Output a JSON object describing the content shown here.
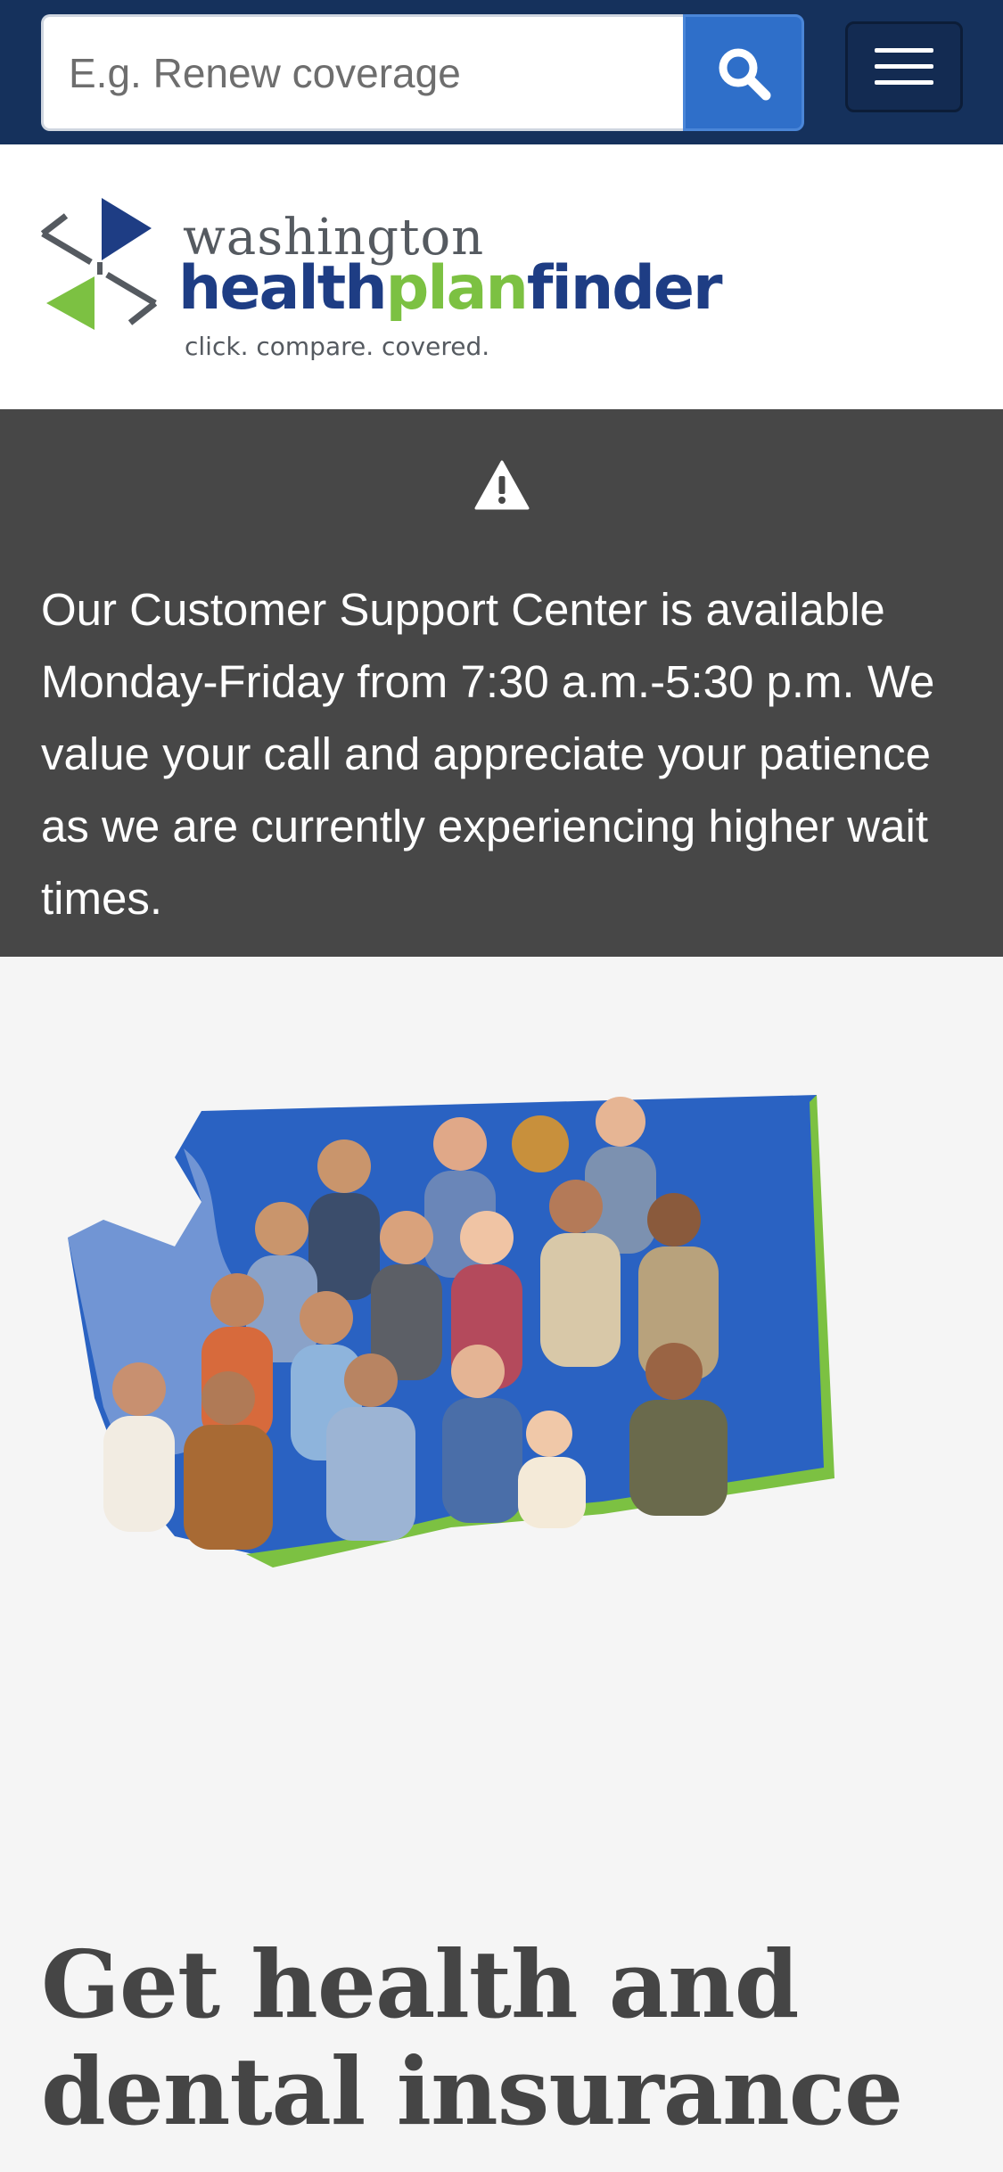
{
  "search": {
    "placeholder": "E.g. Renew coverage",
    "button_icon": "search-icon"
  },
  "menu": {
    "icon": "hamburger-menu-icon"
  },
  "logo": {
    "line1": "washington",
    "line2_part1": "health",
    "line2_part2": "plan",
    "line2_part3": "finder",
    "tagline": "click. compare. covered."
  },
  "alert": {
    "icon": "warning-icon",
    "message": "Our Customer Support Center is available Monday-Friday from 7:30 a.m.-5:30 p.m. We value your call and appreciate your patience as we are currently experiencing higher wait times."
  },
  "hero": {
    "image": "washington-state-people-group-photo",
    "headline": "Get health and dental insurance"
  },
  "colors": {
    "header_bg": "#15315c",
    "search_button": "#2f6fc9",
    "alert_bg": "#474747",
    "brand_blue": "#1e3d84",
    "brand_green": "#7cc142",
    "map_blue": "#2a62c2"
  }
}
